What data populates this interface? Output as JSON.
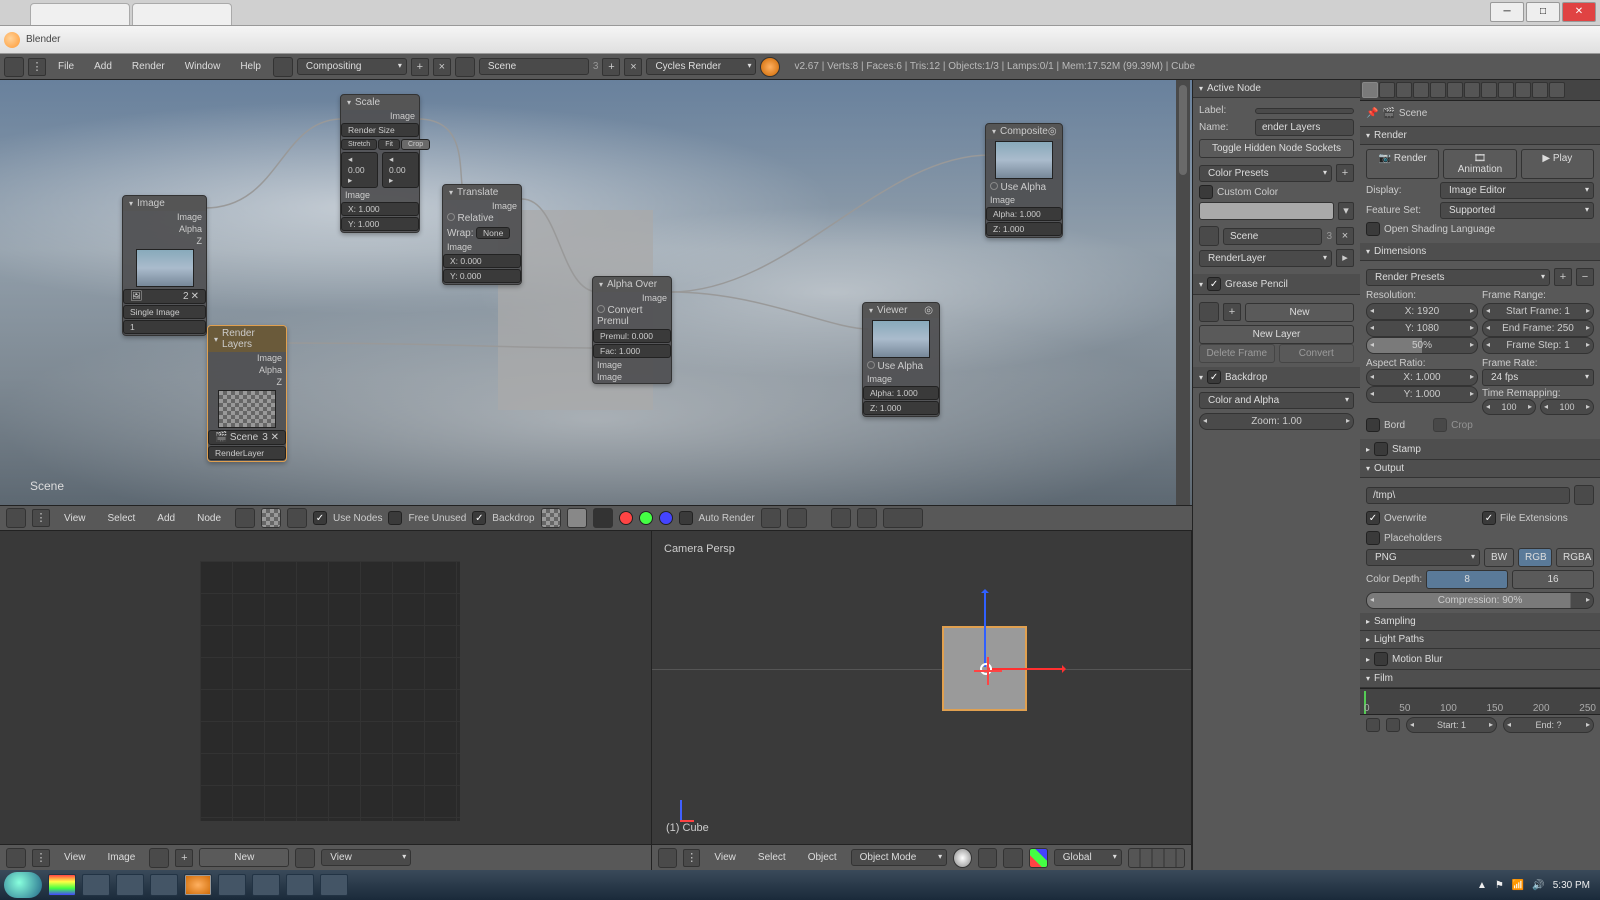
{
  "window": {
    "title": "Blender"
  },
  "win_btns": {
    "min": "─",
    "max": "□",
    "close": "✕"
  },
  "topmenu": {
    "items": [
      "File",
      "Add",
      "Render",
      "Window",
      "Help"
    ],
    "layout": "Compositing",
    "scene": "Scene",
    "engine": "Cycles Render",
    "stats": "v2.67 | Verts:8 | Faces:6 | Tris:12 | Objects:1/3 | Lamps:0/1 | Mem:17.52M (99.39M) | Cube"
  },
  "nodes": {
    "image": {
      "title": "Image",
      "out1": "Image",
      "out2": "Alpha",
      "out3": "Z",
      "src": "Single Image"
    },
    "scale": {
      "title": "Scale",
      "out": "Image",
      "method": "Render Size",
      "f1": "Stretch",
      "f2": "Fit",
      "f3": "Crop",
      "x": "X: 1.000",
      "y": "Y: 1.000",
      "in": "Image"
    },
    "translate": {
      "title": "Translate",
      "out": "Image",
      "rel": "Relative",
      "wrap": "Wrap:",
      "wrapv": "None",
      "x": "X: 0.000",
      "y": "Y: 0.000",
      "in": "Image"
    },
    "renderlayers": {
      "title": "Render Layers",
      "out1": "Image",
      "out2": "Alpha",
      "out3": "Z",
      "scene": "Scene",
      "layer": "RenderLayer"
    },
    "alphaover": {
      "title": "Alpha Over",
      "out": "Image",
      "conv": "Convert Premul",
      "premul": "Premul: 0.000",
      "fac": "Fac: 1.000",
      "in1": "Image",
      "in2": "Image"
    },
    "viewer": {
      "title": "Viewer",
      "usealpha": "Use Alpha",
      "in1": "Image",
      "alpha": "Alpha: 1.000",
      "z": "Z: 1.000"
    },
    "composite": {
      "title": "Composite",
      "usealpha": "Use Alpha",
      "in1": "Image",
      "alpha": "Alpha: 1.000",
      "z": "Z: 1.000"
    }
  },
  "scene_label": "Scene",
  "node_toolbar": {
    "menus": [
      "View",
      "Select",
      "Add",
      "Node"
    ],
    "use_nodes": "Use Nodes",
    "free_unused": "Free Unused",
    "backdrop": "Backdrop",
    "auto_render": "Auto Render"
  },
  "uv_footer": {
    "menus": [
      "View",
      "Image"
    ],
    "new": "New",
    "mode": "View"
  },
  "view3d": {
    "camera": "Camera Persp",
    "obj": "(1) Cube",
    "menus": [
      "View",
      "Select",
      "Object"
    ],
    "mode": "Object Mode",
    "orient": "Global"
  },
  "active_node": {
    "title": "Active Node",
    "label": "Label:",
    "name": "Name:",
    "name_val": "ender Layers",
    "toggle": "Toggle Hidden Node Sockets",
    "color_presets": "Color Presets",
    "custom_color": "Custom Color",
    "scene_val": "Scene",
    "layer_val": "RenderLayer"
  },
  "gp": {
    "title": "Grease Pencil",
    "new": "New",
    "new_layer": "New Layer",
    "del": "Delete Frame",
    "convert": "Convert"
  },
  "backdrop": {
    "title": "Backdrop",
    "mode": "Color and Alpha",
    "zoom": "Zoom: 1.00"
  },
  "scene_panel": {
    "scene": "Scene"
  },
  "render": {
    "title": "Render",
    "render_btn": "Render",
    "anim_btn": "Animation",
    "play_btn": "Play",
    "display": "Display:",
    "display_val": "Image Editor",
    "feature": "Feature Set:",
    "feature_val": "Supported",
    "osl": "Open Shading Language"
  },
  "dimensions": {
    "title": "Dimensions",
    "presets": "Render Presets",
    "resolution": "Resolution:",
    "x": "X: 1920",
    "y": "Y: 1080",
    "pct": "50%",
    "framerange": "Frame Range:",
    "start": "Start Frame: 1",
    "end": "End Frame: 250",
    "step": "Frame Step: 1",
    "aspect": "Aspect Ratio:",
    "ax": "X: 1.000",
    "ay": "Y: 1.000",
    "framerate": "Frame Rate:",
    "fps": "24 fps",
    "remap": "Time Remapping:",
    "r1": "◂ 100 ▸",
    "r2": "◂ 100 ▸",
    "bord": "Bord",
    "crop": "Crop"
  },
  "stamp": "Stamp",
  "output": {
    "title": "Output",
    "path": "/tmp\\",
    "overwrite": "Overwrite",
    "ext": "File Extensions",
    "placeholders": "Placeholders",
    "format": "PNG",
    "bw": "BW",
    "rgb": "RGB",
    "rgba": "RGBA",
    "depth": "Color Depth:",
    "d8": "8",
    "d16": "16",
    "compression": "Compression: 90%"
  },
  "panels2": {
    "sampling": "Sampling",
    "lightpaths": "Light Paths",
    "motionblur": "Motion Blur",
    "film": "Film"
  },
  "timeline": {
    "s50": "50",
    "s100": "100",
    "s150": "150",
    "s200": "200",
    "s250": "250",
    "s0": "0",
    "start": "Start: 1",
    "end": "End: ?"
  },
  "tray": {
    "time": "5:30 PM"
  }
}
